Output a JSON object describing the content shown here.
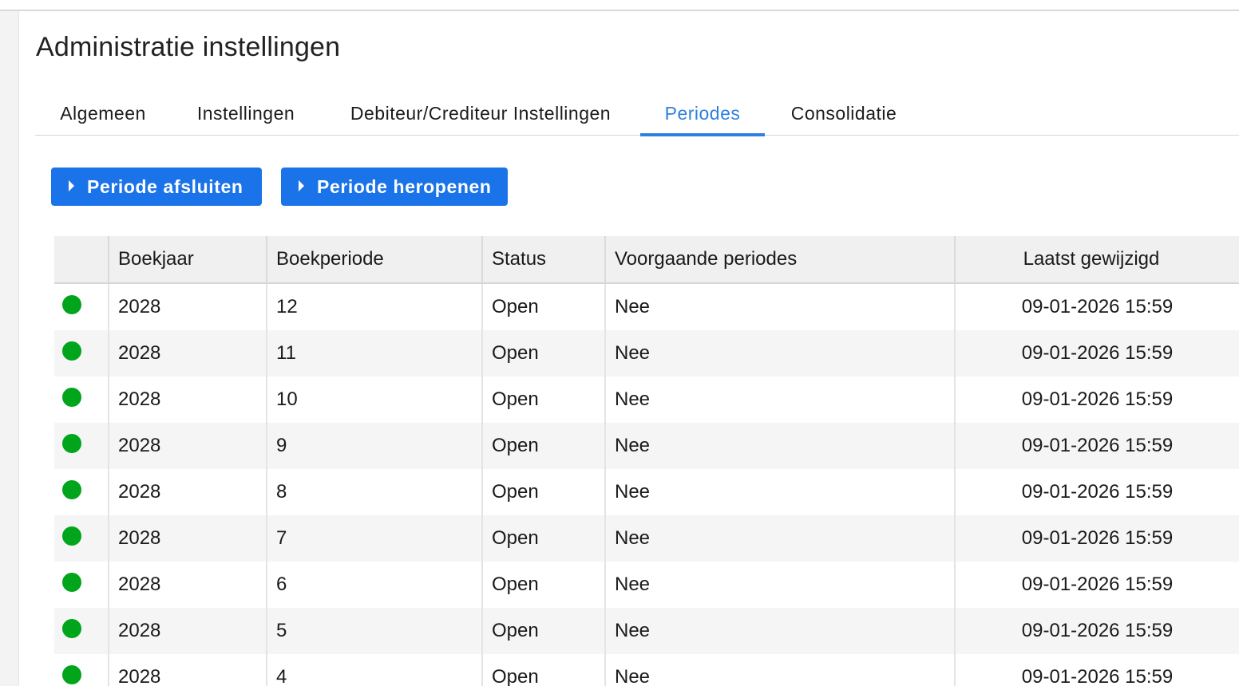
{
  "page": {
    "title": "Administratie instellingen"
  },
  "tabs": [
    {
      "label": "Algemeen",
      "active": false
    },
    {
      "label": "Instellingen",
      "active": false
    },
    {
      "label": "Debiteur/Crediteur Instellingen",
      "active": false
    },
    {
      "label": "Periodes",
      "active": true
    },
    {
      "label": "Consolidatie",
      "active": false
    }
  ],
  "actions": {
    "close_period": "Periode afsluiten",
    "reopen_period": "Periode heropenen"
  },
  "colors": {
    "accent": "#1a73e8",
    "active_tab": "#2f7fe0",
    "status_open": "#00a51b"
  },
  "table": {
    "columns": [
      "Boekjaar",
      "Boekperiode",
      "Status",
      "Voorgaande periodes",
      "Laatst gewijzigd"
    ],
    "rows": [
      {
        "boekjaar": "2028",
        "boekperiode": "12",
        "status": "Open",
        "voorgaande": "Nee",
        "gewijzigd": "09-01-2026 15:59"
      },
      {
        "boekjaar": "2028",
        "boekperiode": "11",
        "status": "Open",
        "voorgaande": "Nee",
        "gewijzigd": "09-01-2026 15:59"
      },
      {
        "boekjaar": "2028",
        "boekperiode": "10",
        "status": "Open",
        "voorgaande": "Nee",
        "gewijzigd": "09-01-2026 15:59"
      },
      {
        "boekjaar": "2028",
        "boekperiode": "9",
        "status": "Open",
        "voorgaande": "Nee",
        "gewijzigd": "09-01-2026 15:59"
      },
      {
        "boekjaar": "2028",
        "boekperiode": "8",
        "status": "Open",
        "voorgaande": "Nee",
        "gewijzigd": "09-01-2026 15:59"
      },
      {
        "boekjaar": "2028",
        "boekperiode": "7",
        "status": "Open",
        "voorgaande": "Nee",
        "gewijzigd": "09-01-2026 15:59"
      },
      {
        "boekjaar": "2028",
        "boekperiode": "6",
        "status": "Open",
        "voorgaande": "Nee",
        "gewijzigd": "09-01-2026 15:59"
      },
      {
        "boekjaar": "2028",
        "boekperiode": "5",
        "status": "Open",
        "voorgaande": "Nee",
        "gewijzigd": "09-01-2026 15:59"
      },
      {
        "boekjaar": "2028",
        "boekperiode": "4",
        "status": "Open",
        "voorgaande": "Nee",
        "gewijzigd": "09-01-2026 15:59"
      }
    ]
  }
}
